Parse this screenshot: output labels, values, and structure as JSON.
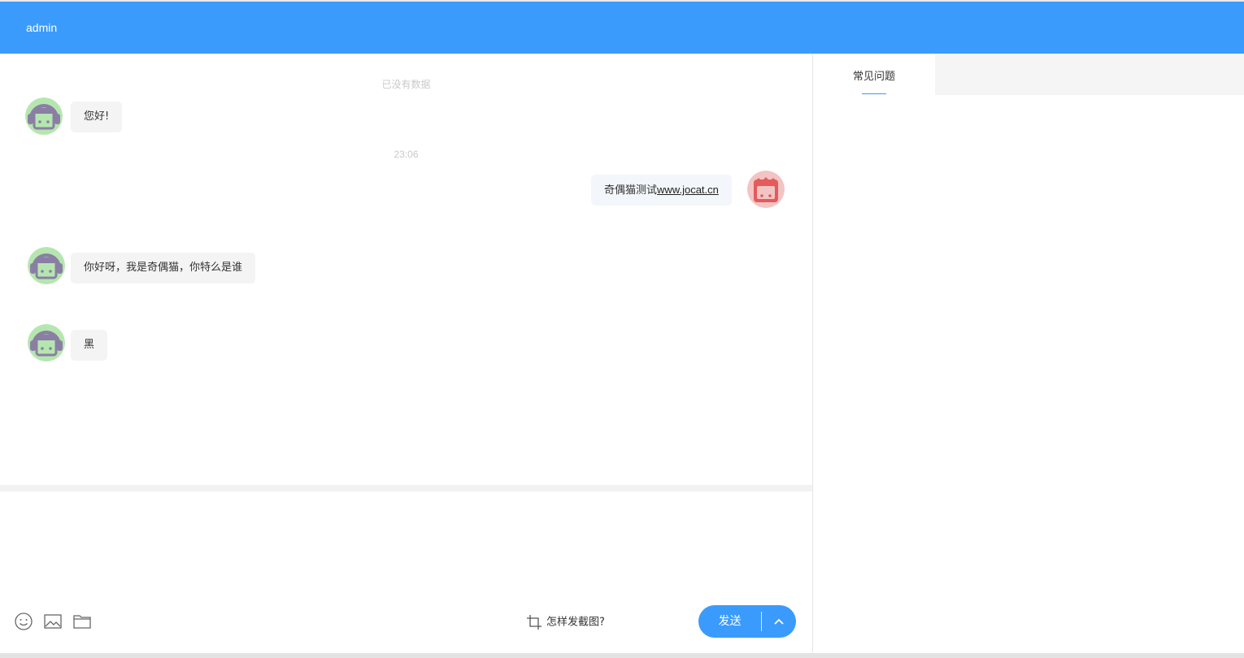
{
  "header": {
    "title": "admin"
  },
  "chat": {
    "no_more": "已没有数据",
    "timestamp": "23:06",
    "messages": [
      {
        "side": "left",
        "text": "您好!"
      },
      {
        "side": "right",
        "text": "奇偶猫测试",
        "link": "www.jocat.cn"
      },
      {
        "side": "left",
        "text": "你好呀，我是奇偶猫，你特么是谁"
      },
      {
        "side": "left",
        "text": "黑"
      }
    ]
  },
  "toolbar": {
    "emoji_icon": "smile-icon",
    "image_icon": "image-icon",
    "file_icon": "folder-icon",
    "screenshot_tip": "怎样发截图?",
    "send_label": "发送"
  },
  "side_panel": {
    "tabs": [
      {
        "label": "常见问题"
      }
    ]
  },
  "colors": {
    "primary": "#3a9bfd",
    "agent_avatar_bg": "#b6e6b0",
    "agent_avatar_fg": "#8a7fa3",
    "user_avatar_bg": "#f2c4c4",
    "user_avatar_fg": "#e55a5a"
  }
}
